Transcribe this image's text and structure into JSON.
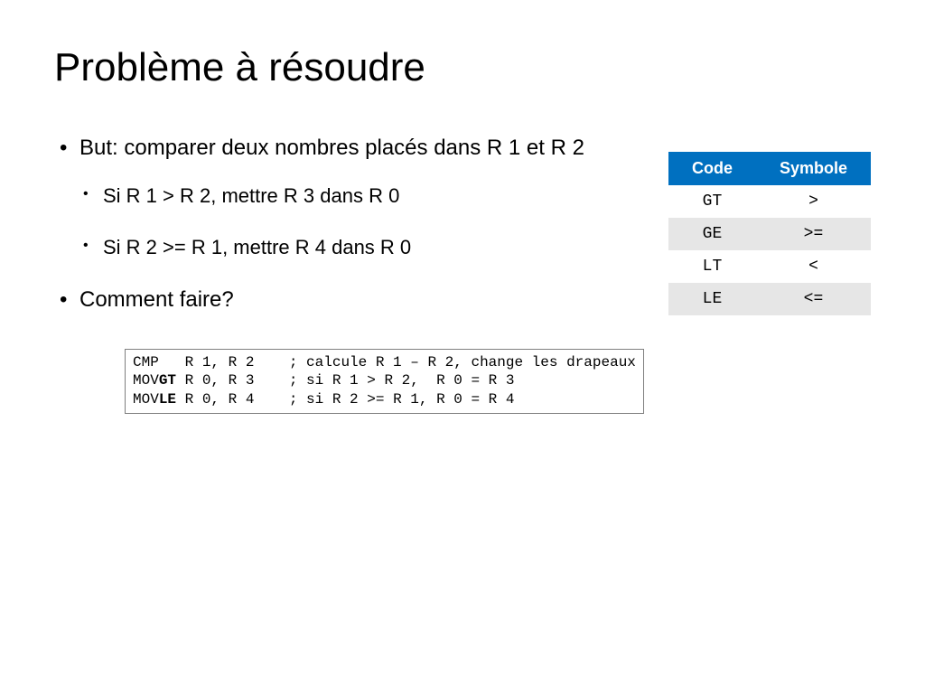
{
  "title": "Problème à résoudre",
  "bullets": {
    "item0": "But: comparer deux nombres placés dans R 1 et R 2",
    "sub0": "Si R 1 > R 2, mettre R 3 dans R 0",
    "sub1": "Si R 2 >= R 1, mettre R 4 dans R 0",
    "item1": "Comment faire?"
  },
  "table": {
    "headers": {
      "c0": "Code",
      "c1": "Symbole"
    },
    "rows": {
      "r0c0": "GT",
      "r0c1": ">",
      "r1c0": "GE",
      "r1c1": ">=",
      "r2c0": "LT",
      "r2c1": "<",
      "r3c0": "LE",
      "r3c1": "<="
    }
  },
  "code": {
    "l0a": "CMP   R 1, R 2",
    "l0b": "    ; calcule R 1 – R 2, change les drapeaux",
    "l1a": "MOV",
    "l1b": "GT",
    "l1c": " R 0, R 3",
    "l1d": "    ; si R 1 > R 2,  R 0 = R 3",
    "l2a": "MOV",
    "l2b": "LE",
    "l2c": " R 0, R 4",
    "l2d": "    ; si R 2 >= R 1, R 0 = R 4"
  }
}
